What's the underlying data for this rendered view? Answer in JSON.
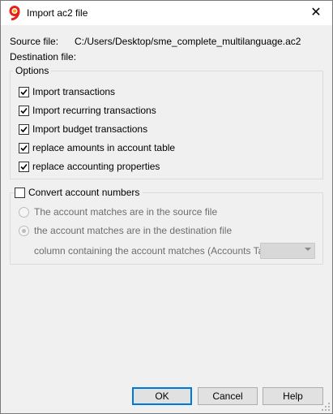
{
  "window": {
    "title": "Import ac2 file",
    "close_glyph": "✕",
    "icon": "banana-app-icon"
  },
  "files": {
    "source_label": "Source file:",
    "source_value": "C:/Users/Desktop/sme_complete_multilanguage.ac2",
    "destination_label": "Destination file:"
  },
  "options": {
    "legend": "Options",
    "items": [
      {
        "label": "Import transactions",
        "checked": true
      },
      {
        "label": "Import recurring transactions",
        "checked": true
      },
      {
        "label": "Import budget transactions",
        "checked": true
      },
      {
        "label": "replace amounts in account table",
        "checked": true
      },
      {
        "label": "replace accounting properties",
        "checked": true
      }
    ]
  },
  "convert": {
    "label": "Convert account numbers",
    "checked": false,
    "radio_source": "The account matches are in the source file",
    "radio_destination": "the account matches are in the destination file",
    "selected_radio": "destination",
    "column_label": "column containing the account matches (Accounts Table)",
    "column_value": ""
  },
  "buttons": {
    "ok": "OK",
    "cancel": "Cancel",
    "help": "Help"
  },
  "colors": {
    "default_button_border": "#0078d7",
    "app_icon_red": "#e2231a",
    "app_icon_orange": "#f7a600"
  }
}
